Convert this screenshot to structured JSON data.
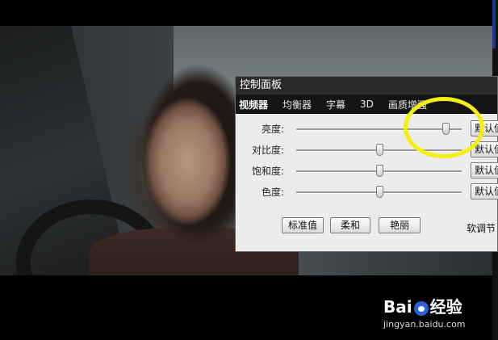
{
  "panel": {
    "title": "控制面板",
    "tabs": [
      "视频器",
      "均衡器",
      "字幕",
      "3D",
      "画质增强"
    ],
    "active_tab": 0,
    "rows": [
      {
        "label": "亮度:",
        "value_fraction": 0.9,
        "default_label": "默认值"
      },
      {
        "label": "对比度:",
        "value_fraction": 0.5,
        "default_label": "默认值"
      },
      {
        "label": "饱和度:",
        "value_fraction": 0.5,
        "default_label": "默认值"
      },
      {
        "label": "色度:",
        "value_fraction": 0.5,
        "default_label": "默认值"
      }
    ],
    "presets": [
      "标准值",
      "柔和",
      "艳丽"
    ],
    "soft_adjust_label": "软调节"
  },
  "annotation": {
    "highlight_color": "#f3f00d"
  },
  "watermark": {
    "logo": "Bai  经验",
    "logo_bai": "Bai",
    "logo_jingyan": "经验",
    "url": "jingyan.baidu.com"
  },
  "colors": {
    "titlebar": "#2b2b2b",
    "tabbar": "#141414",
    "panel_bg": "#ececec"
  }
}
